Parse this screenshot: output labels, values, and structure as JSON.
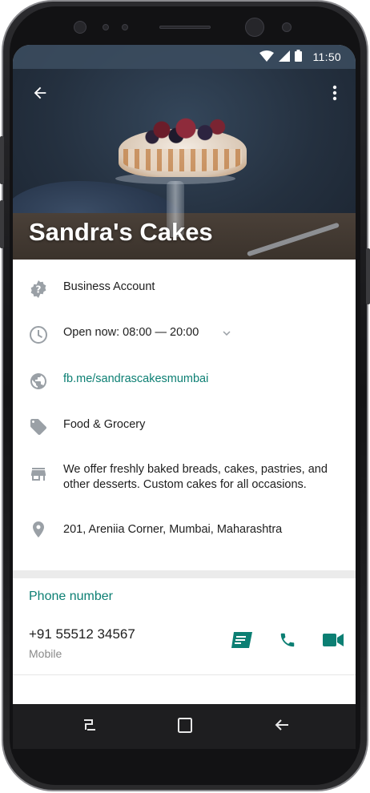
{
  "status_bar": {
    "time": "11:50",
    "icons": [
      "wifi-icon",
      "signal-icon",
      "battery-icon"
    ]
  },
  "header": {
    "title": "Sandra's Cakes",
    "back_icon": "arrow-back-icon",
    "menu_icon": "more-vert-icon"
  },
  "info": {
    "account_type": "Business Account",
    "hours": "Open now: 08:00 — 20:00",
    "website": "fb.me/sandrascakesmumbai",
    "category": "Food & Grocery",
    "description": "We offer freshly baked breads, cakes, pastries, and other desserts. Custom cakes for all occasions.",
    "address": "201, Areniia Corner, Mumbai, Maharashtra"
  },
  "phone": {
    "section_title": "Phone number",
    "number": "+91 55512 34567",
    "type": "Mobile",
    "actions": [
      "message-icon",
      "call-icon",
      "video-call-icon"
    ]
  },
  "colors": {
    "accent": "#0c7f73",
    "icon_gray": "#9aa0a6",
    "text": "#1e1e1e",
    "subtext": "#8a8a8a"
  }
}
